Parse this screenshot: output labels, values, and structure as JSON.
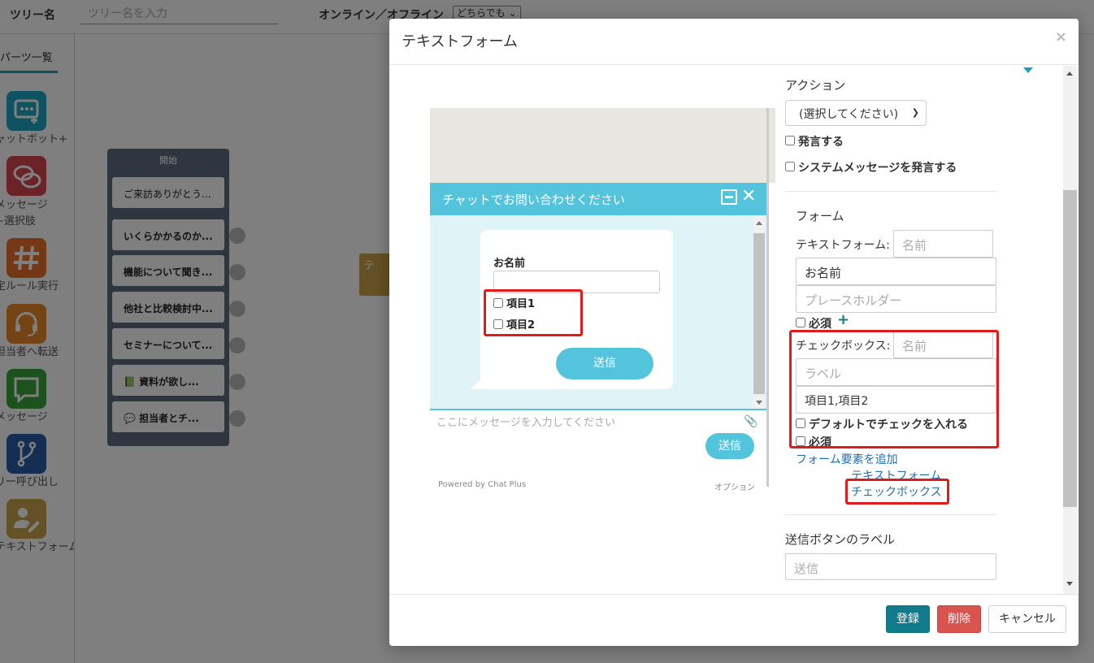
{
  "topbar": {
    "tree_name_label": "ツリー名",
    "tree_name_placeholder": "ツリー名を入力",
    "online_label": "オンライン／オフライン",
    "online_select": "どちらでも ⌄"
  },
  "sidebar": {
    "title": "パーツ一覧",
    "parts": [
      {
        "label": "ャットボット+",
        "icon": "chatbot-icon",
        "color": "#1ea7c4"
      },
      {
        "label": "メッセージ\n+選択肢",
        "icon": "message-choice-icon",
        "color": "#d9464f"
      },
      {
        "label": "定ルール実行",
        "icon": "hashtag-icon",
        "color": "#e8702a"
      },
      {
        "label": "担当者へ転送",
        "icon": "headset-icon",
        "color": "#e8892a"
      },
      {
        "label": "メッセージ",
        "icon": "message-icon",
        "color": "#3aa33a"
      },
      {
        "label": "リー呼び出し",
        "icon": "branch-icon",
        "color": "#2b5fa8"
      },
      {
        "label": "テキストフォーム",
        "icon": "user-edit-icon",
        "color": "#c9a24a"
      }
    ]
  },
  "canvas": {
    "start_title": "開始",
    "items": [
      "ご来訪ありがとう...",
      "いくらかかるのか...",
      "機能について聞き...",
      "他社と比較検討中...",
      "セミナーについて...",
      "📗 資料が欲し...",
      "💬 担当者とチ..."
    ],
    "ghost_text": "テ"
  },
  "modal": {
    "title": "テキストフォーム",
    "close": "×",
    "preview": {
      "header": "チャットでお問い合わせください",
      "field_label": "お名前",
      "checkbox1": "項目1",
      "checkbox2": "項目2",
      "send_pill": "送信",
      "input_placeholder": "ここにメッセージを入力してください",
      "send_button": "送信",
      "powered": "Powered by Chat Plus",
      "option": "オプション"
    },
    "settings": {
      "action_label": "アクション",
      "action_select": "(選択してください)",
      "speak_label": "発言する",
      "system_speak_label": "システムメッセージを発言する",
      "form_label": "フォーム",
      "text_form_label": "テキストフォーム:",
      "text_form_name_placeholder": "名前",
      "text_form_value": "お名前",
      "text_form_placeholder": "プレースホルダー",
      "required_label": "必須",
      "checkbox_label": "チェックボックス:",
      "checkbox_name_placeholder": "名前",
      "checkbox_label_placeholder": "ラベル",
      "checkbox_items": "項目1,項目2",
      "default_check_label": "デフォルトでチェックを入れる",
      "required2_label": "必須",
      "add_form_link": "フォーム要素を追加",
      "add_text_form_link": "テキストフォーム",
      "add_checkbox_link": "チェックボックス",
      "send_button_label": "送信ボタンのラベル",
      "send_button_placeholder": "送信"
    },
    "footer": {
      "register": "登録",
      "delete": "削除",
      "cancel": "キャンセル"
    }
  },
  "colors": {
    "accent": "#117a8b",
    "chat": "#54c4dc",
    "danger": "#d9534f",
    "highlight": "#e01b1b"
  }
}
